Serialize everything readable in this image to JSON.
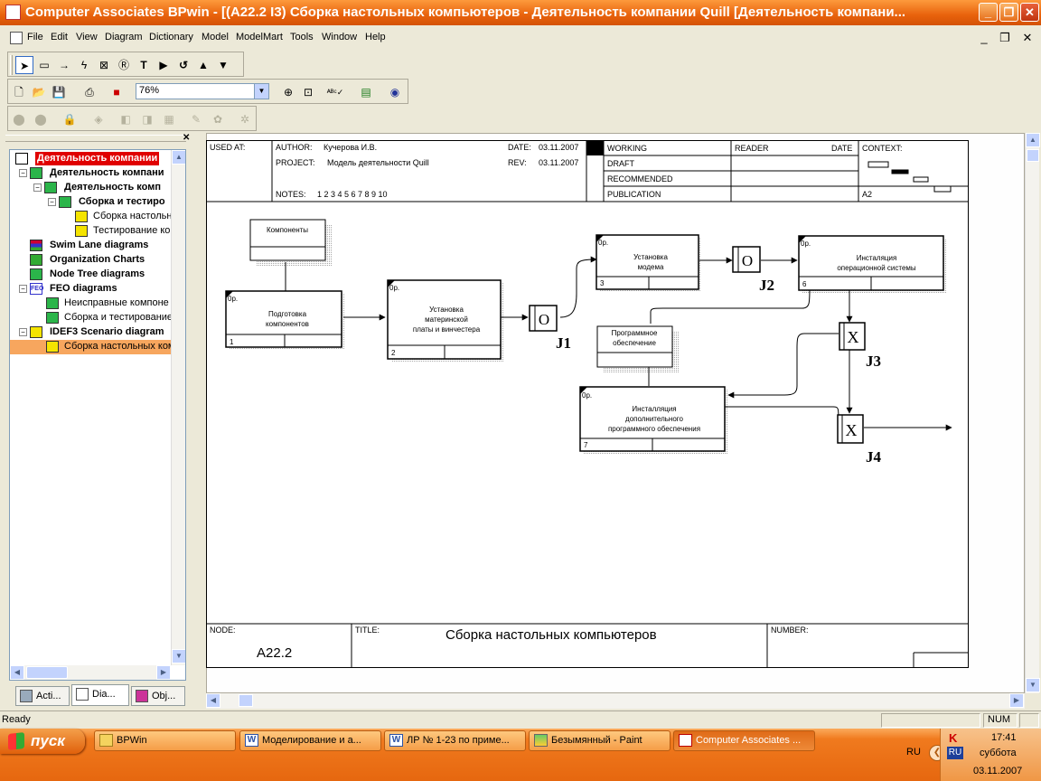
{
  "window": {
    "title": "Computer Associates BPwin - [(A22.2 I3) Сборка настольных компьютеров - Деятельность компании Quill  [Деятельность компани...",
    "minimize_glyph": "_",
    "restore_glyph": "❐",
    "close_glyph": "✕"
  },
  "menu": {
    "items": [
      "File",
      "Edit",
      "View",
      "Diagram",
      "Dictionary",
      "Model",
      "ModelMart",
      "Tools",
      "Window",
      "Help"
    ]
  },
  "toolbar": {
    "zoom_value": "76%"
  },
  "tree": {
    "items": [
      {
        "label": "Деятельность компании",
        "icon": "model-icon",
        "selected_red": true
      },
      {
        "label": "Деятельность компани",
        "icon": "diagram-icon",
        "bold": true
      },
      {
        "label": "Деятельность комп",
        "icon": "diagram-icon",
        "bold": true
      },
      {
        "label": "Сборка и тестиро",
        "icon": "diagram-icon",
        "bold": true
      },
      {
        "label": "Сборка настольн",
        "icon": "idef3-icon"
      },
      {
        "label": "Тестирование ко",
        "icon": "idef3-icon"
      },
      {
        "label": "Swim Lane diagrams",
        "icon": "swimlane-icon",
        "bold": true
      },
      {
        "label": "Organization Charts",
        "icon": "orgchart-icon",
        "bold": true
      },
      {
        "label": "Node Tree diagrams",
        "icon": "nodetree-icon",
        "bold": true
      },
      {
        "label": "FEO diagrams",
        "icon": "feo-icon",
        "bold": true
      },
      {
        "label": "Неисправные компоне",
        "icon": "diagram-icon"
      },
      {
        "label": "Сборка и тестирование",
        "icon": "diagram-icon"
      },
      {
        "label": "IDEF3 Scenario diagram",
        "icon": "idef3-icon",
        "bold": true
      },
      {
        "label": "Сборка настольных комп",
        "icon": "idef3-icon",
        "highlighted": true
      }
    ]
  },
  "tabs": [
    {
      "label": "Acti...",
      "icon": "activities-tab-icon"
    },
    {
      "label": "Dia...",
      "icon": "diagrams-tab-icon",
      "active": true
    },
    {
      "label": "Obj...",
      "icon": "objects-tab-icon"
    }
  ],
  "header": {
    "used_at": "USED AT:",
    "author_label": "AUTHOR:",
    "author": "Кучерова И.В.",
    "project_label": "PROJECT:",
    "project": "Модель деятельности Quill",
    "date_label": "DATE:",
    "date": "03.11.2007",
    "rev_label": "REV:",
    "rev": "03.11.2007",
    "notes_label": "NOTES:",
    "notes": "1  2  3  4  5  6  7  8  9  10",
    "status": [
      "WORKING",
      "DRAFT",
      "RECOMMENDED",
      "PUBLICATION"
    ],
    "reader": "READER",
    "reader_date": "DATE",
    "context": "CONTEXT:",
    "context_node": "A2"
  },
  "diagram": {
    "objects": [
      {
        "id": "obj-components",
        "label": "Компоненты"
      },
      {
        "id": "obj-software",
        "label": "Программное\nобеспечение"
      }
    ],
    "uows": [
      {
        "id": "uow-1",
        "label": "Подготовка\nкомпонентов",
        "tag": "0р.",
        "num": "1"
      },
      {
        "id": "uow-2",
        "label": "Установка\nматеринской\nплаты и винчестера",
        "tag": "0р.",
        "num": "2"
      },
      {
        "id": "uow-3",
        "label": "Установка\nмодема",
        "tag": "0р.",
        "num": "3"
      },
      {
        "id": "uow-6",
        "label": "Инсталяция\nоперационной системы",
        "tag": "0р.",
        "num": "6"
      },
      {
        "id": "uow-7",
        "label": "Инсталляция\nдополнительного\nпрограммного обеспечения",
        "tag": "0р.",
        "num": "7"
      }
    ],
    "junctions": [
      {
        "id": "J1",
        "symbol": "O",
        "label": "J1"
      },
      {
        "id": "J2",
        "symbol": "O",
        "label": "J2"
      },
      {
        "id": "J3",
        "symbol": "X",
        "label": "J3"
      },
      {
        "id": "J4",
        "symbol": "X",
        "label": "J4"
      }
    ]
  },
  "footer": {
    "node_label": "NODE:",
    "node": "A22.2",
    "title_label": "TITLE:",
    "title": "Сборка настольных компьютеров",
    "number_label": "NUMBER:"
  },
  "status_bar": {
    "text": "Ready",
    "num": "NUM"
  },
  "taskbar": {
    "start": "пуск",
    "buttons": [
      {
        "label": "BPWin",
        "icon": "folder-icon"
      },
      {
        "label": "Моделирование и а...",
        "icon": "word-icon"
      },
      {
        "label": "ЛР № 1-23 по приме...",
        "icon": "word-icon"
      },
      {
        "label": "Безымянный - Paint",
        "icon": "paint-icon"
      },
      {
        "label": "Computer Associates ...",
        "icon": "bpwin-icon",
        "active": true
      }
    ],
    "lang": "RU",
    "time": "17:41",
    "day": "суббота",
    "date": "03.11.2007"
  }
}
